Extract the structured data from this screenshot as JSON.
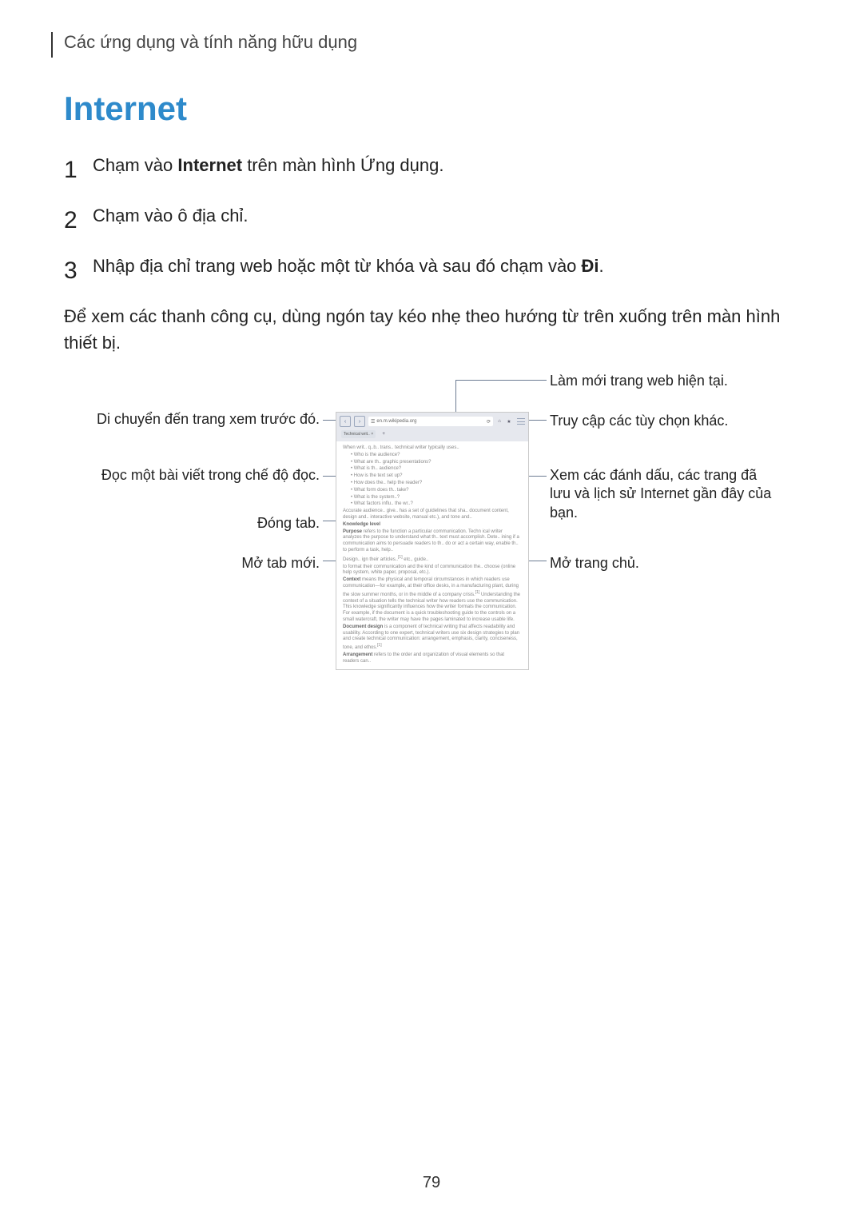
{
  "breadcrumb": "Các ứng dụng và tính năng hữu dụng",
  "title": "Internet",
  "steps": [
    {
      "num": "1",
      "pre": "Chạm vào ",
      "bold": "Internet",
      "post": " trên màn hình Ứng dụng."
    },
    {
      "num": "2",
      "pre": "Chạm vào ô địa chỉ.",
      "bold": "",
      "post": ""
    },
    {
      "num": "3",
      "pre": "Nhập địa chỉ trang web hoặc một từ khóa và sau đó chạm vào ",
      "bold": "Đi",
      "post": "."
    }
  ],
  "paragraph": "Để xem các thanh công cụ, dùng ngón tay kéo nhẹ theo hướng từ trên xuống trên màn hình thiết bị.",
  "callouts_left": [
    "Di chuyển đến trang xem trước đó.",
    "Đọc một bài viết trong chế độ đọc.",
    "Đóng tab.",
    "Mở tab mới."
  ],
  "callouts_right": [
    "Làm mới trang web hiện tại.",
    "Truy cập các tùy chọn khác.",
    "Xem các đánh dấu, các trang đã lưu và lịch sử Internet gần đây của bạn.",
    "Mở trang chủ."
  ],
  "phone": {
    "url": "en.m.wikipedia.org",
    "tab_label": "Technical writ.."
  },
  "page_number": "79"
}
